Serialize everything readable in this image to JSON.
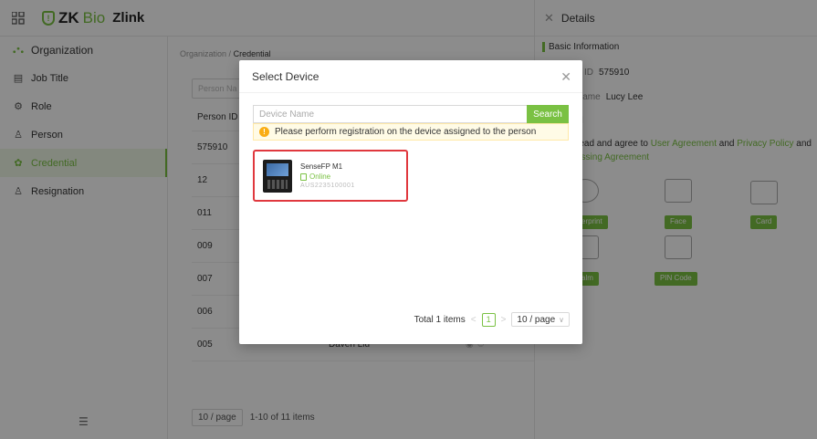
{
  "app": {
    "logo_brand_zk": "ZK",
    "logo_brand_bio": "Bio",
    "logo_product": "Zlink"
  },
  "sidebar": {
    "org": "Organization",
    "items": [
      {
        "label": "Job Title",
        "icon": "briefcase-icon"
      },
      {
        "label": "Role",
        "icon": "role-icon"
      },
      {
        "label": "Person",
        "icon": "person-icon"
      },
      {
        "label": "Credential",
        "icon": "credential-icon"
      },
      {
        "label": "Resignation",
        "icon": "resignation-icon"
      }
    ],
    "collapse_glyph": "☰"
  },
  "main": {
    "breadcrumb_root": "Organization",
    "breadcrumb_sep": "/",
    "breadcrumb_current": "Credential",
    "filter_placeholder": "Person Na",
    "col_person_id": "Person ID",
    "rows": [
      {
        "id": "575910",
        "name": ""
      },
      {
        "id": "12",
        "name": ""
      },
      {
        "id": "011",
        "name": ""
      },
      {
        "id": "009",
        "name": ""
      },
      {
        "id": "007",
        "name": ""
      },
      {
        "id": "006",
        "name": ""
      },
      {
        "id": "005",
        "name": "Daven Liu"
      }
    ],
    "page_size": "10 / page",
    "range": "1-10 of 11 items"
  },
  "details": {
    "title": "Details",
    "basic_info": "Basic Information",
    "id_label": "ID",
    "id_value": "575910",
    "name_label": "Name",
    "name_value": "Lucy Lee",
    "section2": "al",
    "agree_prefix": "read and agree to",
    "user_agreement": "User Agreement",
    "and1": "and",
    "privacy_policy": "Privacy Policy",
    "and2": "and",
    "processing": "essing Agreement",
    "fingerprint": "erprint",
    "face": "Face",
    "card": "Card",
    "palm": "alm",
    "pin": "PIN Code"
  },
  "modal": {
    "title": "Select Device",
    "search_placeholder": "Device Name",
    "search_button": "Search",
    "notice": "Please perform registration on the device assigned to the person",
    "device": {
      "name": "SenseFP M1",
      "status": "Online",
      "serial": "AUS2235100001"
    },
    "total": "Total 1 items",
    "current_page": "1",
    "page_size": "10 / page",
    "prev": "<",
    "next": ">"
  },
  "colors": {
    "accent": "#7ac143",
    "highlight_border": "#e0383e",
    "warning": "#faad14"
  }
}
